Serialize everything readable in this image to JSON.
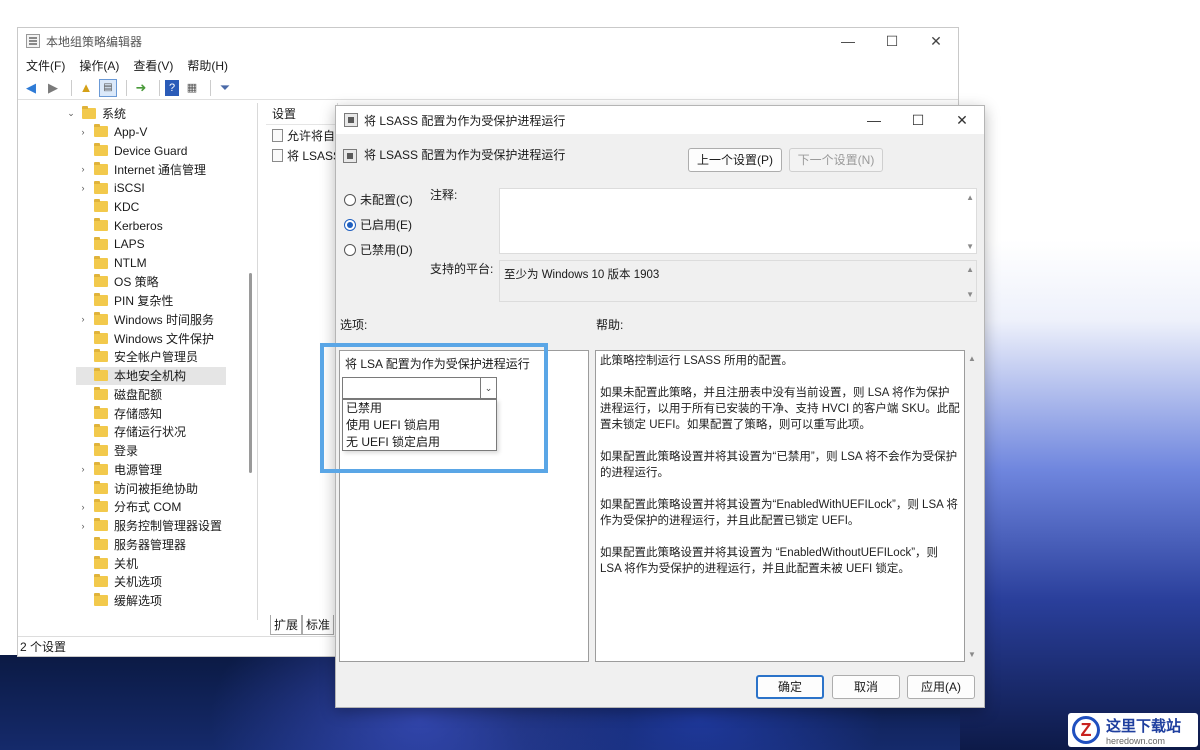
{
  "main_window": {
    "title": "本地组策略编辑器",
    "controls": {
      "minimize": "—",
      "maximize": "☐",
      "close": "✕"
    },
    "menu": [
      "文件(F)",
      "操作(A)",
      "查看(V)",
      "帮助(H)"
    ],
    "tree": [
      {
        "label": "系统",
        "chevron": "⌄",
        "level": 0
      },
      {
        "label": "App-V",
        "chevron": "›",
        "level": 1
      },
      {
        "label": "Device Guard",
        "chevron": "",
        "level": 1
      },
      {
        "label": "Internet 通信管理",
        "chevron": "›",
        "level": 1
      },
      {
        "label": "iSCSI",
        "chevron": "›",
        "level": 1
      },
      {
        "label": "KDC",
        "chevron": "",
        "level": 1
      },
      {
        "label": "Kerberos",
        "chevron": "",
        "level": 1
      },
      {
        "label": "LAPS",
        "chevron": "",
        "level": 1
      },
      {
        "label": "NTLM",
        "chevron": "",
        "level": 1
      },
      {
        "label": "OS 策略",
        "chevron": "",
        "level": 1
      },
      {
        "label": "PIN 复杂性",
        "chevron": "",
        "level": 1
      },
      {
        "label": "Windows 时间服务",
        "chevron": "›",
        "level": 1
      },
      {
        "label": "Windows 文件保护",
        "chevron": "",
        "level": 1
      },
      {
        "label": "安全帐户管理员",
        "chevron": "",
        "level": 1
      },
      {
        "label": "本地安全机构",
        "chevron": "",
        "level": 1,
        "selected": true
      },
      {
        "label": "磁盘配额",
        "chevron": "",
        "level": 1
      },
      {
        "label": "存储感知",
        "chevron": "",
        "level": 1
      },
      {
        "label": "存储运行状况",
        "chevron": "",
        "level": 1
      },
      {
        "label": "登录",
        "chevron": "",
        "level": 1
      },
      {
        "label": "电源管理",
        "chevron": "›",
        "level": 1
      },
      {
        "label": "访问被拒绝协助",
        "chevron": "",
        "level": 1
      },
      {
        "label": "分布式 COM",
        "chevron": "›",
        "level": 1
      },
      {
        "label": "服务控制管理器设置",
        "chevron": "›",
        "level": 1
      },
      {
        "label": "服务器管理器",
        "chevron": "",
        "level": 1
      },
      {
        "label": "关机",
        "chevron": "",
        "level": 1
      },
      {
        "label": "关机选项",
        "chevron": "",
        "level": 1
      },
      {
        "label": "缓解选项",
        "chevron": "",
        "level": 1
      }
    ],
    "list_header": "设置",
    "list_rows": [
      "允许将自",
      "将 LSASS"
    ],
    "tabs": [
      "扩展",
      "标准"
    ],
    "status": "2 个设置"
  },
  "dialog": {
    "title": "将 LSASS 配置为作为受保护进程运行",
    "header": "将 LSASS 配置为作为受保护进程运行",
    "prev_button": "上一个设置(P)",
    "next_button": "下一个设置(N)",
    "radios": [
      {
        "label": "未配置(C)",
        "checked": false
      },
      {
        "label": "已启用(E)",
        "checked": true
      },
      {
        "label": "已禁用(D)",
        "checked": false
      }
    ],
    "comment_label": "注释:",
    "comment_value": "",
    "platform_label": "支持的平台:",
    "platform_value": "至少为 Windows 10 版本 1903",
    "options_label": "选项:",
    "help_label": "帮助:",
    "option_title": "将 LSA 配置为作为受保护进程运行",
    "combo_value": "",
    "dropdown_options": [
      "已禁用",
      "使用 UEFI 锁启用",
      "无 UEFI 锁定启用"
    ],
    "help_paragraphs": [
      "此策略控制运行 LSASS 所用的配置。",
      "如果未配置此策略，并且注册表中没有当前设置，则 LSA 将作为保护进程运行，以用于所有已安装的干净、支持 HVCI 的客户端 SKU。此配置未锁定 UEFI。如果配置了策略，则可以重写此项。",
      "如果配置此策略设置并将其设置为“已禁用”，则 LSA 将不会作为受保护的进程运行。",
      "如果配置此策略设置并将其设置为“EnabledWithUEFILock”，则 LSA 将作为受保护的进程运行，并且此配置已锁定 UEFI。",
      "如果配置此策略设置并将其设置为 “EnabledWithoutUEFILock”，则 LSA 将作为受保护的进程运行，并且此配置未被 UEFI 锁定。"
    ],
    "ok_button": "确定",
    "cancel_button": "取消",
    "apply_button": "应用(A)",
    "controls": {
      "minimize": "—",
      "maximize": "☐",
      "close": "✕"
    }
  },
  "watermark": {
    "logo": "Z",
    "cn": "这里下载站",
    "en": "heredown.com"
  },
  "colors": {
    "highlight": "#5aa6e6",
    "accent": "#2b73c9"
  }
}
